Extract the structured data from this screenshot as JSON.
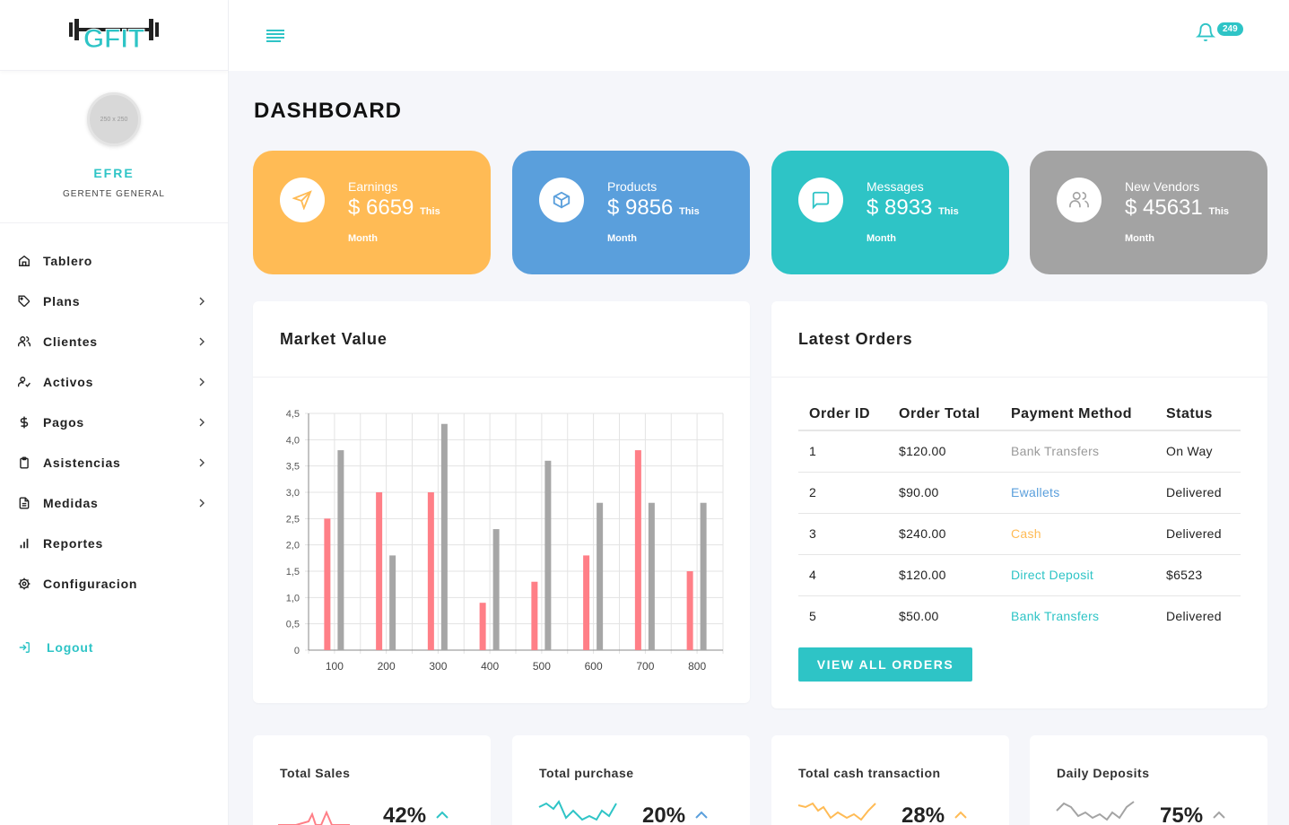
{
  "app": {
    "logo_text": "GFIT",
    "notification_count": "249"
  },
  "profile": {
    "avatar_placeholder": "250 x 250",
    "name": "EFRE",
    "role": "GERENTE GENERAL"
  },
  "sidebar": {
    "items": [
      {
        "label": "Tablero",
        "icon": "home-icon",
        "has_submenu": false
      },
      {
        "label": "Plans",
        "icon": "tag-icon",
        "has_submenu": true
      },
      {
        "label": "Clientes",
        "icon": "users-icon",
        "has_submenu": true
      },
      {
        "label": "Activos",
        "icon": "user-check-icon",
        "has_submenu": true
      },
      {
        "label": "Pagos",
        "icon": "dollar-icon",
        "has_submenu": true
      },
      {
        "label": "Asistencias",
        "icon": "clipboard-icon",
        "has_submenu": true
      },
      {
        "label": "Medidas",
        "icon": "file-text-icon",
        "has_submenu": true
      },
      {
        "label": "Reportes",
        "icon": "bar-chart-icon",
        "has_submenu": false
      },
      {
        "label": "Configuracion",
        "icon": "gear-icon",
        "has_submenu": false
      }
    ],
    "logout_label": "Logout"
  },
  "page": {
    "title": "DASHBOARD"
  },
  "stats": [
    {
      "label": "Earnings",
      "value": "$ 6659",
      "suffix": "This",
      "month": "Month",
      "color": "#ffbb55",
      "icon": "send-icon"
    },
    {
      "label": "Products",
      "value": "$ 9856",
      "suffix": "This",
      "month": "Month",
      "color": "#5a9fdc",
      "icon": "box-icon"
    },
    {
      "label": "Messages",
      "value": "$ 8933",
      "suffix": "This",
      "month": "Month",
      "color": "#2ec4c6",
      "icon": "message-icon"
    },
    {
      "label": "New Vendors",
      "value": "$ 45631",
      "suffix": "This",
      "month": "Month",
      "color": "#a3a3a3",
      "icon": "users-icon"
    }
  ],
  "market": {
    "title": "Market Value"
  },
  "chart_data": {
    "type": "bar",
    "categories": [
      "100",
      "200",
      "300",
      "400",
      "500",
      "600",
      "700",
      "800"
    ],
    "series": [
      {
        "values": [
          2.5,
          3.0,
          3.0,
          0.9,
          1.3,
          1.8,
          3.8,
          1.5
        ],
        "color": "#ff7f87"
      },
      {
        "values": [
          3.8,
          1.8,
          4.3,
          2.3,
          3.6,
          2.8,
          2.8,
          2.8
        ],
        "color": "#a6a6a6"
      }
    ],
    "ylim": [
      0,
      4.5
    ],
    "yticks": [
      "0",
      "0,5",
      "1,0",
      "1,5",
      "2,0",
      "2,5",
      "3,0",
      "3,5",
      "4,0",
      "4,5"
    ],
    "grid": true
  },
  "orders": {
    "title": "Latest Orders",
    "columns": [
      "Order ID",
      "Order Total",
      "Payment Method",
      "Status"
    ],
    "rows": [
      {
        "id": "1",
        "total": "$120.00",
        "method": "Bank Transfers",
        "method_color": "#9a9a9a",
        "status": "On Way"
      },
      {
        "id": "2",
        "total": "$90.00",
        "method": "Ewallets",
        "method_color": "#5a9fdc",
        "status": "Delivered"
      },
      {
        "id": "3",
        "total": "$240.00",
        "method": "Cash",
        "method_color": "#ffbb55",
        "status": "Delivered"
      },
      {
        "id": "4",
        "total": "$120.00",
        "method": "Direct Deposit",
        "method_color": "#2ec4c6",
        "status": "$6523"
      },
      {
        "id": "5",
        "total": "$50.00",
        "method": "Bank Transfers",
        "method_color": "#2ec4c6",
        "status": "Delivered"
      }
    ],
    "button_label": "VIEW ALL ORDERS"
  },
  "mini_cards": [
    {
      "title": "Total Sales",
      "percent": "42%",
      "color": "#ff7f87"
    },
    {
      "title": "Total purchase",
      "percent": "20%",
      "color": "#2ec4c6"
    },
    {
      "title": "Total cash transaction",
      "percent": "28%",
      "color": "#ffbb55"
    },
    {
      "title": "Daily Deposits",
      "percent": "75%",
      "color": "#a3a3a3"
    }
  ]
}
